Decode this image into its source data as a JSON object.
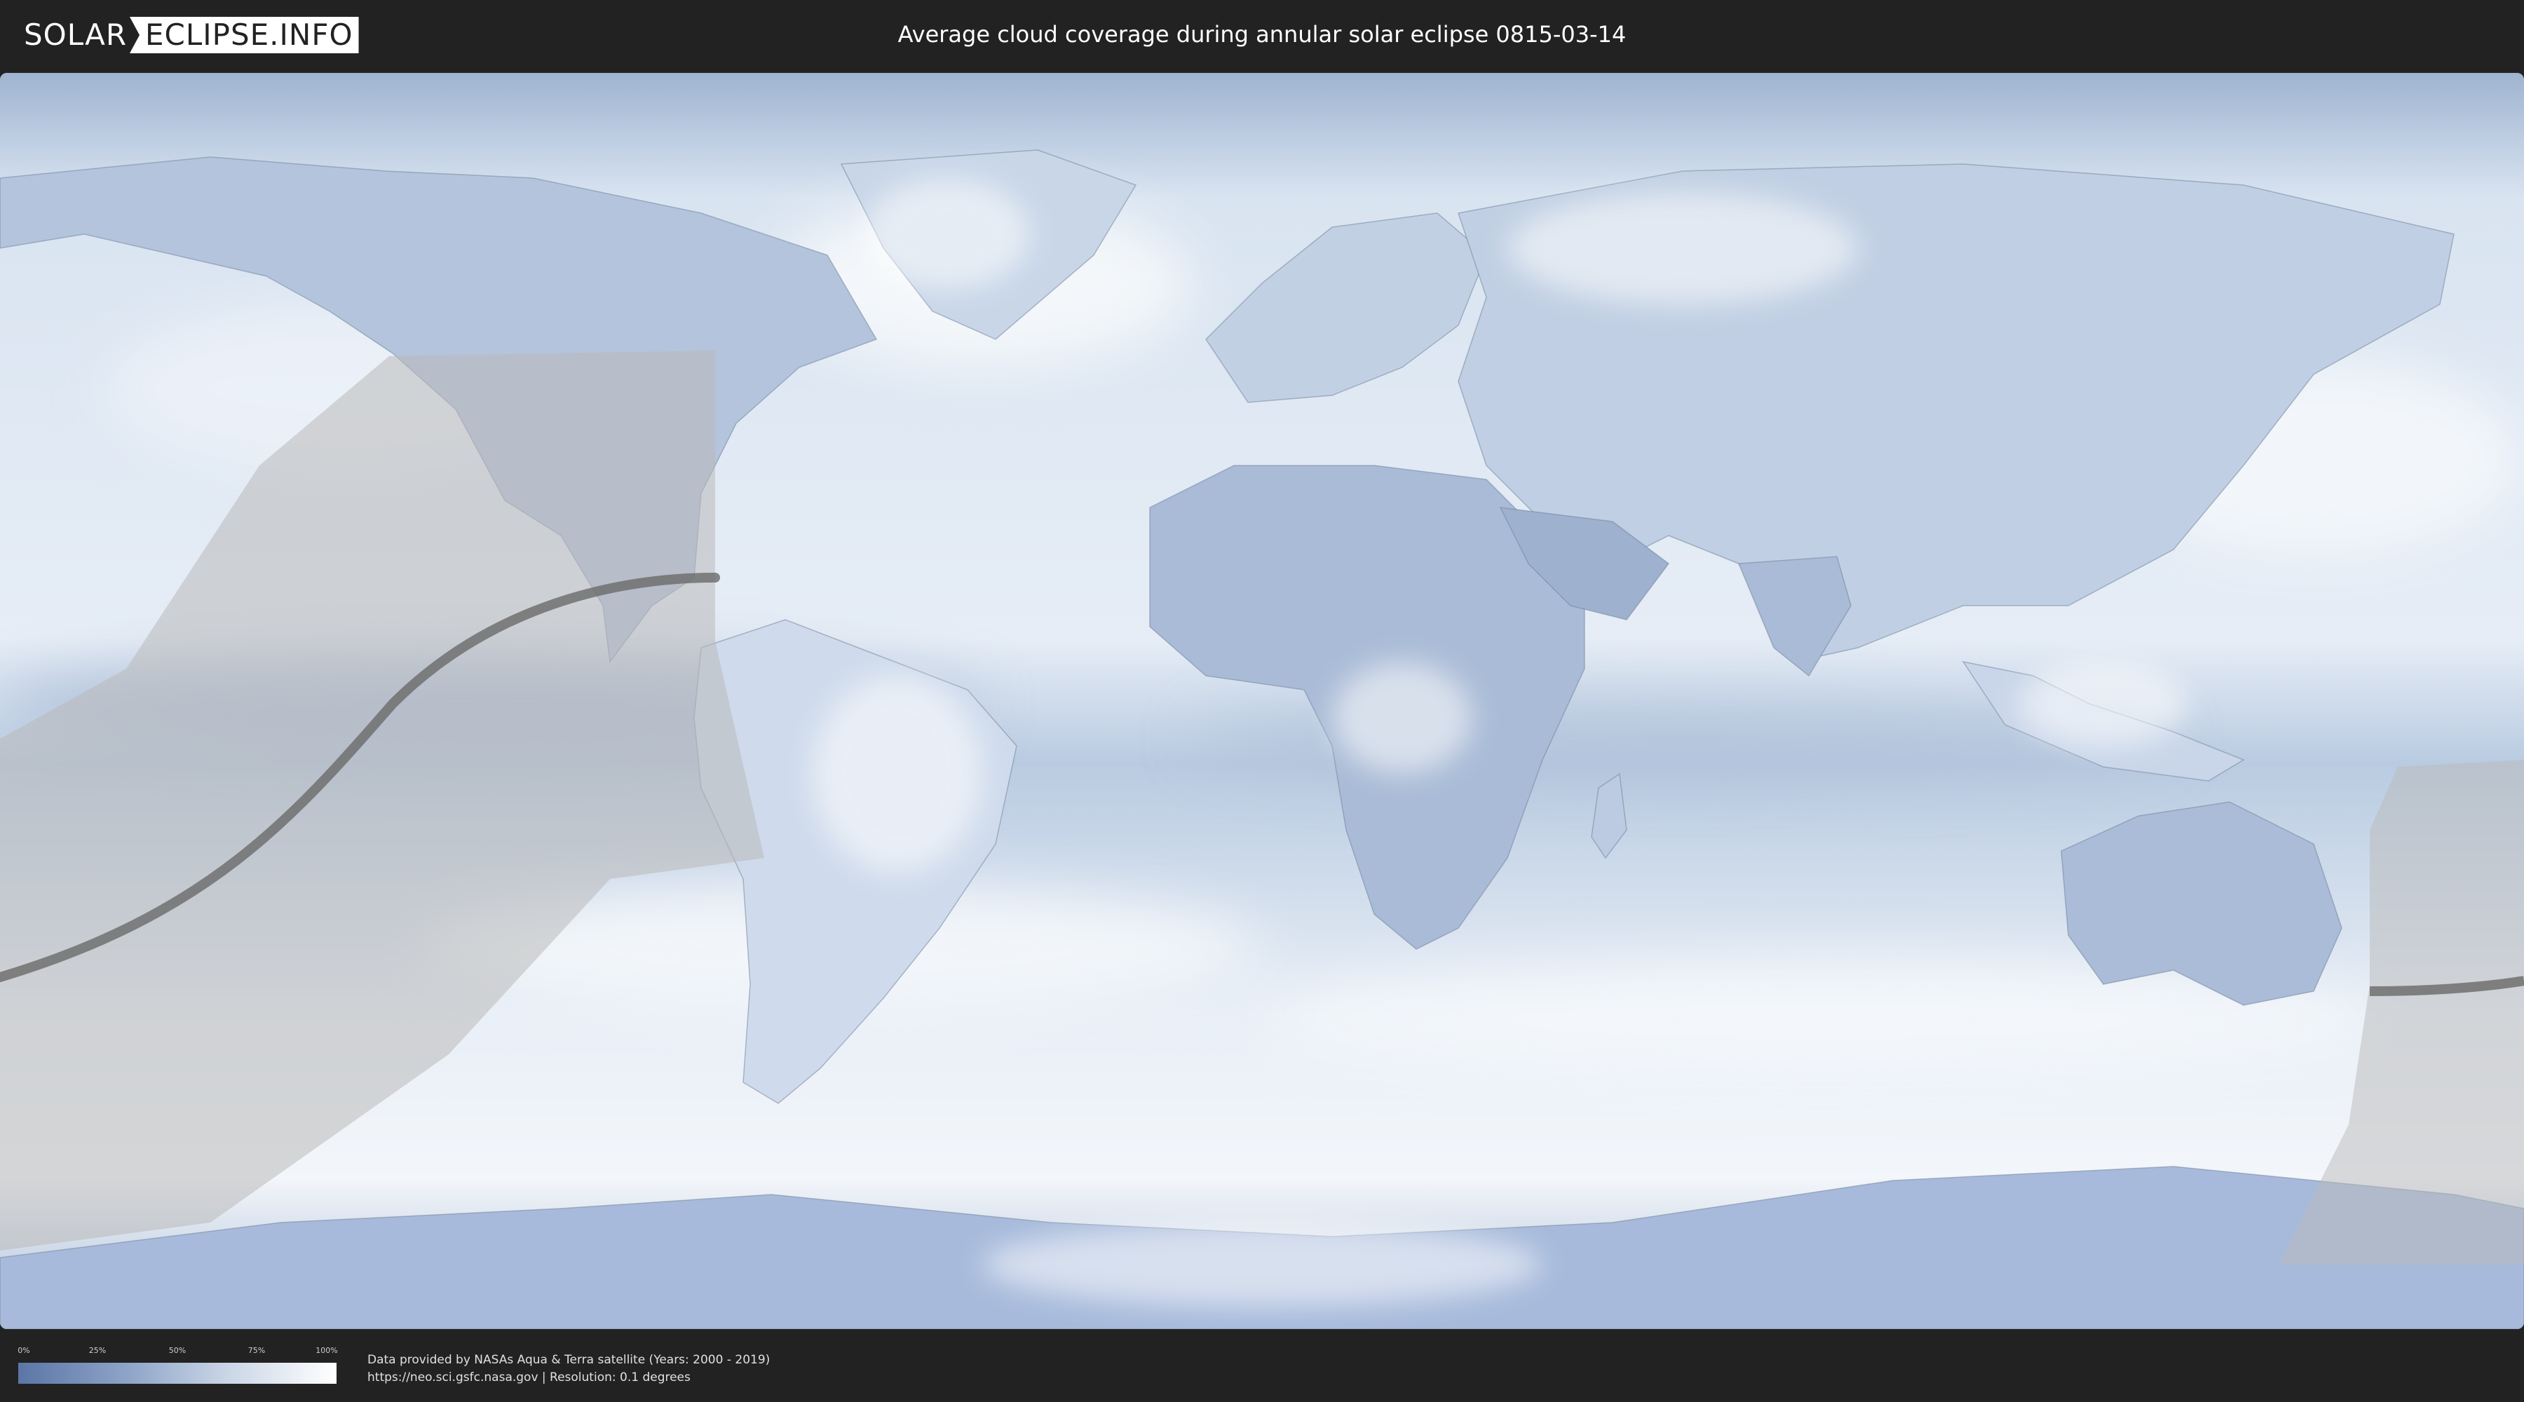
{
  "header": {
    "logo_left": "SOLAR",
    "logo_right": "ECLIPSE.INFO",
    "title": "Average cloud coverage during annular solar eclipse 0815-03-14"
  },
  "legend": {
    "ticks": [
      "0%",
      "25%",
      "50%",
      "75%",
      "100%"
    ],
    "color_low": "#5b76a6",
    "color_high": "#ffffff"
  },
  "credits": {
    "line1": "Data provided by NASAs Aqua & Terra satellite (Years: 2000 - 2019)",
    "line2": "https://neo.sci.gsfc.nasa.gov | Resolution: 0.1 degrees"
  },
  "colors": {
    "background": "#222222",
    "ocean_cloud": "#dfe8f3",
    "clear_sky": "#7d95bd",
    "visibility_zone": "#c8c8c8",
    "eclipse_path": "#707070"
  }
}
